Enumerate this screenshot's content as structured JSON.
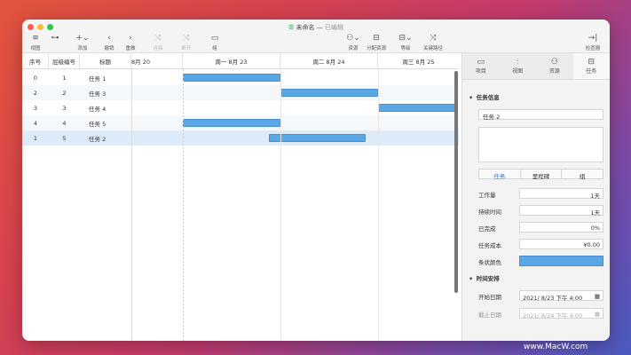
{
  "window": {
    "title": "未命名",
    "status": "已编辑"
  },
  "toolbar": {
    "left": [
      {
        "label": "视图",
        "icon": "view-icon"
      },
      {
        "label": "",
        "icon": "hierarchy-icon"
      },
      {
        "label": "添加",
        "icon": "plus-icon"
      },
      {
        "label": "撤销",
        "icon": "undo-icon"
      },
      {
        "label": "重做",
        "icon": "redo-icon"
      },
      {
        "label": "连接",
        "icon": "connect-icon"
      },
      {
        "label": "断开",
        "icon": "disconnect-icon"
      },
      {
        "label": "组",
        "icon": "group-icon"
      }
    ],
    "right": [
      {
        "label": "资源",
        "icon": "resource-icon"
      },
      {
        "label": "分配资源",
        "icon": "assign-icon"
      },
      {
        "label": "等级",
        "icon": "level-icon"
      },
      {
        "label": "关键路径",
        "icon": "critical-path-icon"
      },
      {
        "label": "检查器",
        "icon": "inspector-icon"
      }
    ]
  },
  "table": {
    "headers": [
      "序号",
      "层级编号",
      "标题"
    ],
    "rows": [
      [
        "0",
        "1",
        "任务 1"
      ],
      [
        "2",
        "2",
        "任务 3"
      ],
      [
        "3",
        "3",
        "任务 4"
      ],
      [
        "4",
        "4",
        "任务 5"
      ],
      [
        "1",
        "5",
        "任务 2"
      ]
    ]
  },
  "gantt": {
    "dates": [
      "8月 20",
      "周一 8月 23",
      "周二 8月 24",
      "周三 8月 25"
    ],
    "bar_color": "#5aa7e6"
  },
  "inspector": {
    "tabs": [
      "项目",
      "视图",
      "资源",
      "任务"
    ],
    "task_info": "任务信息",
    "task_name": "任务 2",
    "notes": "",
    "segments": [
      "任务",
      "里程碑",
      "组"
    ],
    "fields": [
      {
        "label": "工作量",
        "value": "1天"
      },
      {
        "label": "持续时间",
        "value": "1天"
      },
      {
        "label": "已完成",
        "value": "0%"
      },
      {
        "label": "任务成本",
        "value": "¥0.00"
      },
      {
        "label": "条状颜色",
        "value": ""
      }
    ],
    "schedule": "时间安排",
    "start_label": "开始日期",
    "start": "2021/ 8/23 下午 4:00",
    "end_label": "截止日期",
    "end": "2021/ 8/24 下午 4:00"
  },
  "watermark": "www.MacW.com"
}
